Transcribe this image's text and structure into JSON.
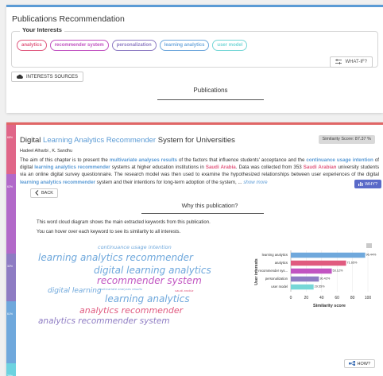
{
  "page": {
    "title": "Publications Recommendation"
  },
  "interests": {
    "legend": "Your Interests",
    "chips": [
      {
        "label": "analytics",
        "color": "#e05a7f"
      },
      {
        "label": "recommender system",
        "color": "#c154c1"
      },
      {
        "label": "personalization",
        "color": "#8e7cc3"
      },
      {
        "label": "learning analytics",
        "color": "#6fa8dc"
      },
      {
        "label": "user model",
        "color": "#76d7d7"
      }
    ],
    "whatif_label": "WHAT-IF?"
  },
  "sources_button": {
    "label": "INTERESTS SOURCES"
  },
  "publications_tab": {
    "label": "Publications"
  },
  "sidebar": {
    "segments": [
      {
        "label": "68%",
        "color": "#e06688"
      },
      {
        "label": "62%",
        "color": "#b269c9"
      },
      {
        "label": "32%",
        "color": "#8e7cc3"
      },
      {
        "label": "61%",
        "color": "#6fa8dc"
      },
      {
        "label": "29%",
        "color": "#6dd3e0"
      }
    ]
  },
  "paper": {
    "title_prefix": "Digital ",
    "title_highlight": "Learning Analytics Recommender",
    "title_suffix": " System for Universities",
    "similarity": "Similarity Score: 87.37 %",
    "authors": "Hadeel Alharbi , K. Sandhu",
    "abstract": [
      {
        "t": "The aim of this chapter is to present the ",
        "c": ""
      },
      {
        "t": "multivariate analyses results",
        "c": "hl-blue"
      },
      {
        "t": " of the factors that influence students' acceptance and the ",
        "c": ""
      },
      {
        "t": "continuance usage intention",
        "c": "hl-blue"
      },
      {
        "t": " of digital ",
        "c": ""
      },
      {
        "t": "learning analytics recommender",
        "c": "hl-blue"
      },
      {
        "t": " systems at higher education institutions in ",
        "c": ""
      },
      {
        "t": "Saudi Arabia",
        "c": "hl-pink"
      },
      {
        "t": ". Data was collected from 353 ",
        "c": ""
      },
      {
        "t": "Saudi Arabian",
        "c": "hl-pink"
      },
      {
        "t": " university students via an online digital survey questionnaire. The research model was then used to examine the hypothesized relationships between user experiences of the digital ",
        "c": ""
      },
      {
        "t": "learning analytics recommender",
        "c": "hl-blue"
      },
      {
        "t": " system and their intentions for long-term adoption of the system, ... ",
        "c": ""
      },
      {
        "t": "show more",
        "c": "more"
      }
    ]
  },
  "why_button": {
    "label": "WHY?"
  },
  "back_button": {
    "label": "BACK"
  },
  "why_section": {
    "title": "Why this publication?",
    "line1": "This word cloud diagram shows the main extracted keywords from this publication.",
    "line2": "You can hover over each keyword to see its similarity to all interests."
  },
  "word_cloud": [
    {
      "text": "continuance usage intention",
      "color": "#6fa8dc"
    },
    {
      "text": "learning analytics recommender",
      "color": "#6fa8dc"
    },
    {
      "text": "digital learning analytics",
      "color": "#6fa8dc"
    },
    {
      "text": "recommender system",
      "color": "#c154c1"
    },
    {
      "text": "digital learning",
      "color": "#6fa8dc"
    },
    {
      "text": "multivariate analyses results",
      "color": "#6fa8dc"
    },
    {
      "text": "saudi arabia",
      "color": "#e05a7f"
    },
    {
      "text": "learning analytics",
      "color": "#6fa8dc"
    },
    {
      "text": "analytics recommender",
      "color": "#e05a7f"
    },
    {
      "text": "analytics recommender system",
      "color": "#8e7cc3"
    }
  ],
  "chart_data": {
    "type": "bar",
    "orientation": "horizontal",
    "categories": [
      "learning analytics",
      "analytics",
      "recommender sys...",
      "personalization",
      "user model"
    ],
    "values": [
      96.44,
      71.65,
      53.12,
      36.42,
      29.55
    ],
    "value_labels": [
      "96.44%",
      "71.65%",
      "53.12%",
      "36.42%",
      "29.55%"
    ],
    "colors": [
      "#6fa8dc",
      "#e05a7f",
      "#c154c1",
      "#8e7cc3",
      "#76d7d7"
    ],
    "xlabel": "Similarity score",
    "ylabel": "User interests",
    "xlim": [
      0,
      100
    ],
    "ticks": [
      "0",
      "20",
      "40",
      "60",
      "80",
      "100"
    ]
  },
  "how_button": {
    "label": "HOW?"
  }
}
